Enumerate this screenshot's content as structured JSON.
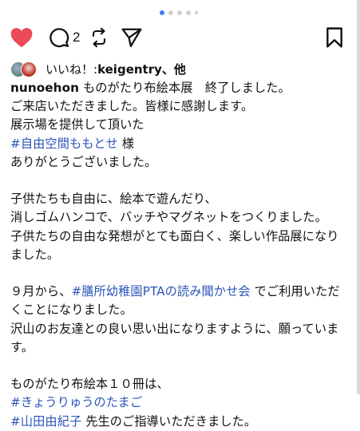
{
  "carousel": {
    "count": 5,
    "active_index": 0
  },
  "actions": {
    "like_icon": "heart-filled-icon",
    "like_color": "#ed4956",
    "comment_icon": "comment-icon",
    "comment_count": "2",
    "repost_icon": "repost-icon",
    "share_icon": "send-icon",
    "save_icon": "bookmark-icon"
  },
  "likes": {
    "label": "いいね！: ",
    "names": "keigentry、他"
  },
  "caption": {
    "username": "nunoehon",
    "line1_text": " ものがたり布絵本展　終了しました。",
    "line2": "ご来店いただきました。皆様に感謝します。",
    "line3": "展示場を提供して頂いた",
    "line4_tag": "#自由空間ももとせ",
    "line4_suffix": " 様",
    "line5": "ありがとうございました。",
    "line7": "子供たちも自由に、絵本で遊んだり、",
    "line8": "消しゴムハンコで、バッチやマグネットをつくりました。",
    "line9": "子供たちの自由な発想がとても面白く、楽しい作品展になりました。",
    "line11_prefix": "９月から、",
    "line11_tag": "#膳所幼稚園PTAの読み聞かせ会",
    "line11_suffix": " でご利用いただくことになりました。",
    "line12": "沢山のお友達との良い思い出になりますように、願っています。",
    "line14": "ものがたり布絵本１０冊は、",
    "line15_tag": "#きょうりゅうのたまご",
    "line16_tag": "#山田由紀子",
    "line16_suffix": " 先生のご指導いただきました。"
  },
  "colors": {
    "hashtag": "#2c55b8",
    "active_dot": "#3b82f6",
    "inactive_dot": "#cfcfcf"
  }
}
